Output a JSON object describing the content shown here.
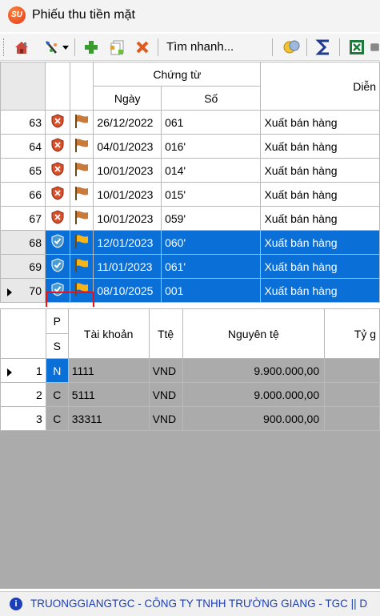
{
  "window": {
    "title": "Phiếu thu tiền mặt",
    "logo_text": "SU"
  },
  "toolbar": {
    "search_text": "Tìm nhanh...",
    "icons": [
      "home-icon",
      "filter-icon",
      "dropdown-icon",
      "add-icon",
      "copy-icon",
      "delete-icon",
      "search-coins-icon",
      "sum-icon",
      "excel-icon"
    ]
  },
  "top_grid": {
    "headers": {
      "group": "Chứng từ",
      "date": "Ngày",
      "number": "Số",
      "desc": "Diễn"
    },
    "rows": [
      {
        "n": "63",
        "date": "26/12/2022",
        "num": "061",
        "desc": "Xuất bán hàng",
        "state": "locked",
        "selected": false
      },
      {
        "n": "64",
        "date": "04/01/2023",
        "num": "016'",
        "desc": "Xuất bán hàng",
        "state": "locked",
        "selected": false
      },
      {
        "n": "65",
        "date": "10/01/2023",
        "num": "014'",
        "desc": "Xuất bán hàng",
        "state": "locked",
        "selected": false
      },
      {
        "n": "66",
        "date": "10/01/2023",
        "num": "015'",
        "desc": "Xuất bán hàng",
        "state": "locked",
        "selected": false
      },
      {
        "n": "67",
        "date": "10/01/2023",
        "num": "059'",
        "desc": "Xuất bán hàng",
        "state": "locked",
        "selected": false
      },
      {
        "n": "68",
        "date": "12/01/2023",
        "num": "060'",
        "desc": "Xuất bán hàng",
        "state": "ok",
        "selected": true
      },
      {
        "n": "69",
        "date": "11/01/2023",
        "num": "061'",
        "desc": "Xuất bán hàng",
        "state": "ok",
        "selected": true
      },
      {
        "n": "70",
        "date": "08/10/2025",
        "num": "001",
        "desc": "Xuất bán hàng",
        "state": "ok",
        "selected": true,
        "current": true
      }
    ]
  },
  "bottom_grid": {
    "headers": {
      "p": "P",
      "s": "S",
      "account": "Tài khoản",
      "currency": "Ttệ",
      "amount": "Nguyên tệ",
      "rate": "Tỷ g"
    },
    "rows": [
      {
        "n": "1",
        "ps": "N",
        "account": "1111",
        "currency": "VND",
        "amount": "9.900.000,00",
        "current": true
      },
      {
        "n": "2",
        "ps": "C",
        "account": "5111",
        "currency": "VND",
        "amount": "9.000.000,00"
      },
      {
        "n": "3",
        "ps": "C",
        "account": "33311",
        "currency": "VND",
        "amount": "900.000,00"
      }
    ]
  },
  "status": {
    "text": "TRUONGGIANGTGC - CÔNG TY TNHH TRƯỜNG GIANG - TGC || D"
  }
}
